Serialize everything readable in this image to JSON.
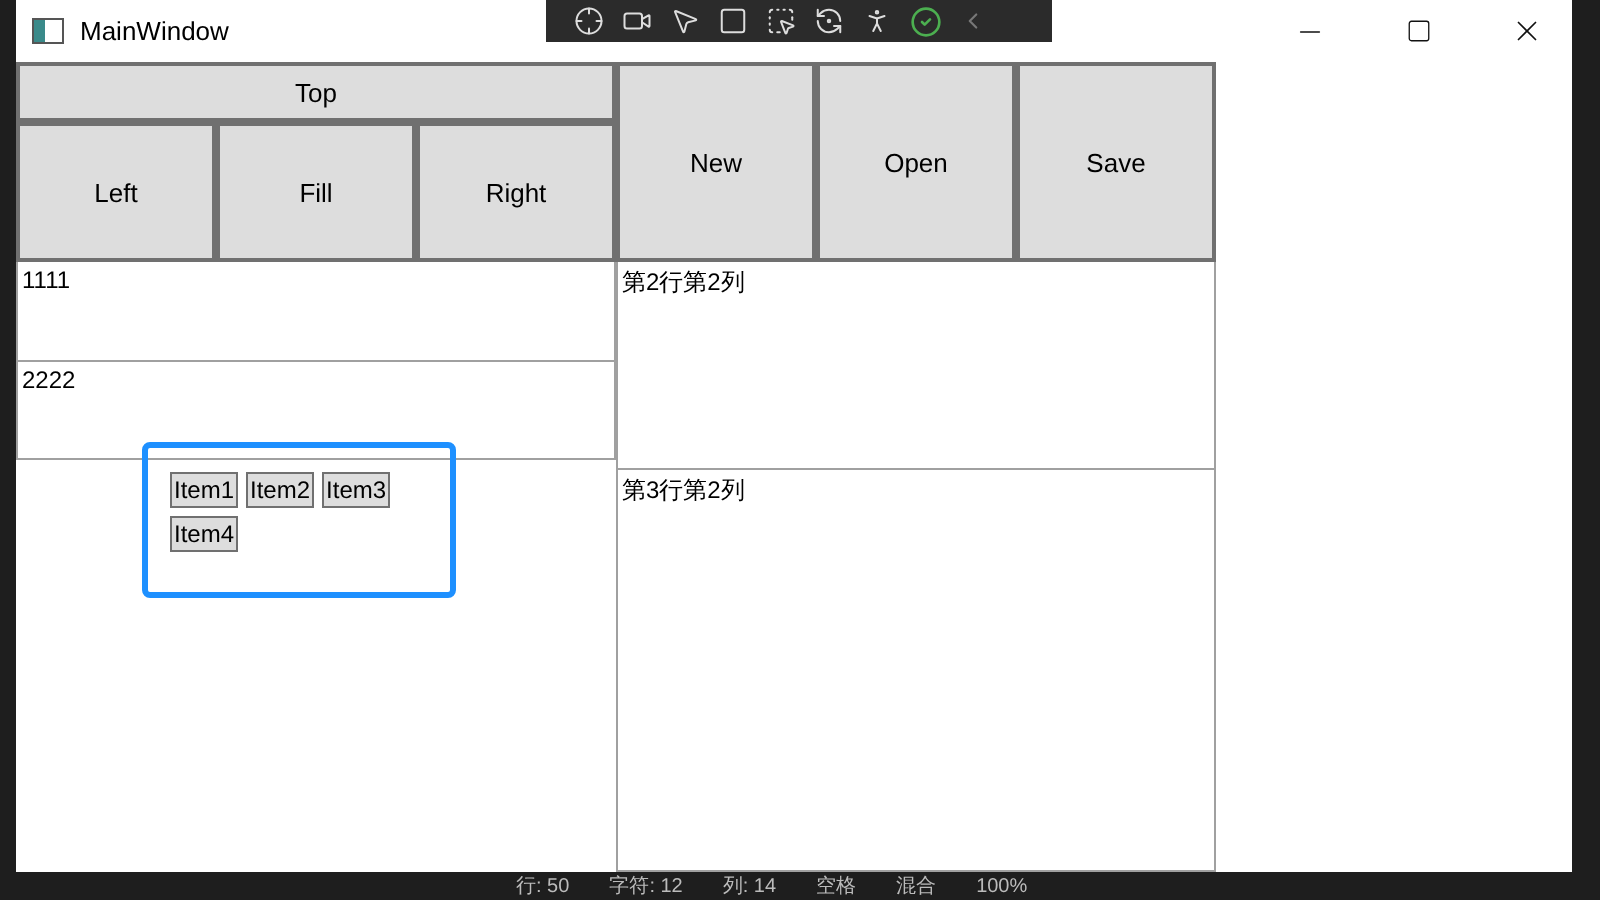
{
  "window": {
    "title": "MainWindow"
  },
  "dock_panel": {
    "top": "Top",
    "left": "Left",
    "fill": "Fill",
    "right": "Right"
  },
  "toolbar_buttons": [
    "New",
    "Open",
    "Save"
  ],
  "stack_cells": [
    "1111",
    "2222"
  ],
  "wrap_items": [
    "Item1",
    "Item2",
    "Item3",
    "Item4"
  ],
  "grid_cells": [
    "第2行第2列",
    "第3行第2列"
  ],
  "status_bar": [
    "行: 50",
    "字符: 12",
    "列: 14",
    "空格",
    "混合",
    "100%"
  ]
}
